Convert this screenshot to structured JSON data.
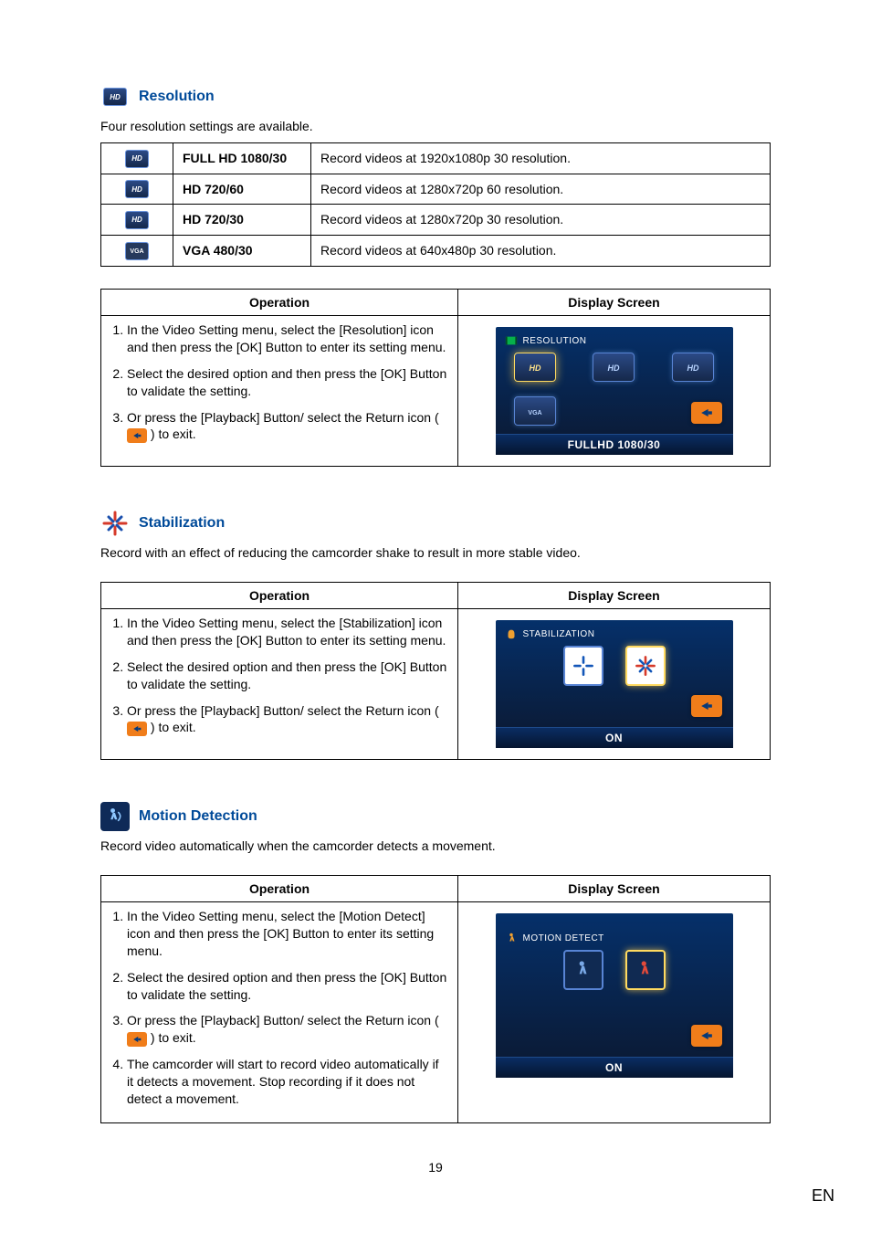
{
  "sections": {
    "resolution": {
      "title": "Resolution",
      "intro": "Four resolution settings are available.",
      "rows": [
        {
          "icon": "hd",
          "name": "FULL HD 1080/30",
          "desc": "Record videos at 1920x1080p 30 resolution."
        },
        {
          "icon": "hd",
          "name": "HD 720/60",
          "desc": "Record videos at 1280x720p 60 resolution."
        },
        {
          "icon": "hd",
          "name": "HD 720/30",
          "desc": "Record videos at 1280x720p 30 resolution."
        },
        {
          "icon": "vga",
          "name": "VGA 480/30",
          "desc": "Record videos at 640x480p 30 resolution."
        }
      ],
      "op_header": "Operation",
      "disp_header": "Display Screen",
      "steps": {
        "s1": "In the Video Setting menu, select the [Resolution] icon and then press the [OK] Button to enter its setting menu.",
        "s2": "Select the desired option and then press the [OK] Button to validate the setting.",
        "s3a": "Or press the [Playback] Button/ select the Return icon (",
        "s3b": ") to exit."
      },
      "screen": {
        "title": "RESOLUTION",
        "footer": "FULLHD 1080/30"
      }
    },
    "stabilization": {
      "title": "Stabilization",
      "intro": "Record with an effect of reducing the camcorder shake to result in more stable video.",
      "op_header": "Operation",
      "disp_header": "Display Screen",
      "steps": {
        "s1": "In the Video Setting menu, select the [Stabilization] icon and then press the [OK] Button to enter its setting menu.",
        "s2": "Select the desired option and then press the [OK] Button to validate the setting.",
        "s3a": "Or press the [Playback] Button/ select the Return icon (",
        "s3b": ") to exit."
      },
      "screen": {
        "title": "STABILIZATION",
        "footer": "ON"
      }
    },
    "motion": {
      "title": "Motion Detection",
      "intro": "Record video automatically when the camcorder detects a movement.",
      "op_header": "Operation",
      "disp_header": "Display Screen",
      "steps": {
        "s1": "In the Video Setting menu, select the [Motion Detect] icon and then press the [OK] Button to enter its setting menu.",
        "s2": "Select the desired option and then press the [OK] Button to validate the setting.",
        "s3a": "Or press the [Playback] Button/ select the Return icon (",
        "s3b": ") to exit.",
        "s4": "The camcorder will start to record video automatically if it detects a movement. Stop recording if it does not detect a movement."
      },
      "screen": {
        "title": "MOTION DETECT",
        "footer": "ON"
      }
    }
  },
  "page_num": "19",
  "lang": "EN"
}
